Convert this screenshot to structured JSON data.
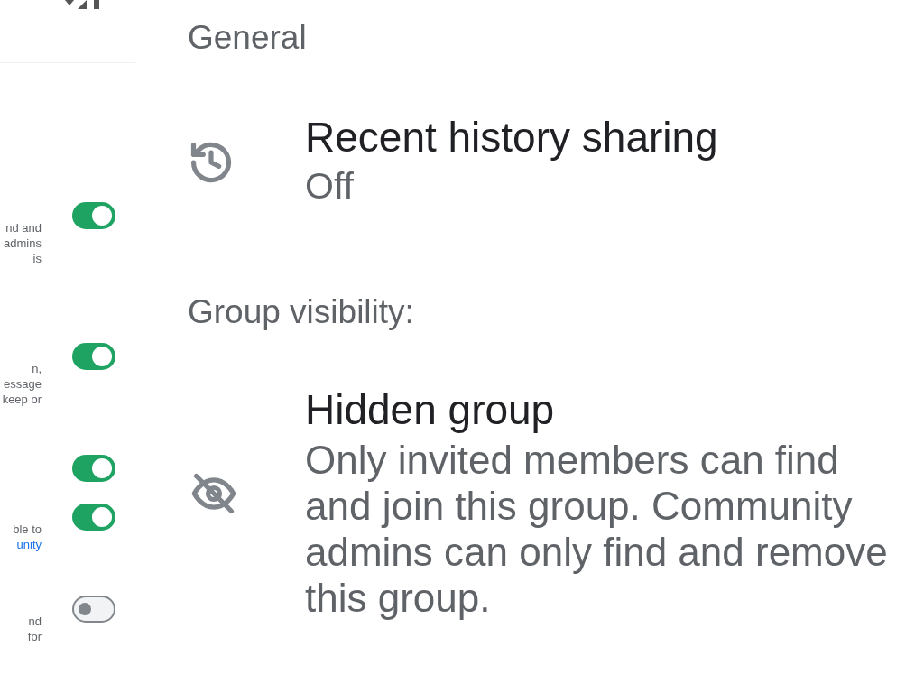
{
  "side_panel": {
    "rows": [
      {
        "lines": [
          {
            "text": "nd and",
            "link": false
          },
          {
            "text": "admins",
            "link": false
          },
          {
            "text": "is",
            "link": false
          }
        ],
        "on": true
      },
      {
        "lines": [
          {
            "text": "n,",
            "link": false
          },
          {
            "text": "essage",
            "link": false
          },
          {
            "text": "keep or",
            "link": false
          }
        ],
        "on": true
      },
      {
        "lines": [],
        "on": true
      },
      {
        "lines": [
          {
            "text": "ble to",
            "link": false
          },
          {
            "text": "unity",
            "link": true
          }
        ],
        "on": true
      },
      {
        "lines": [
          {
            "text": "nd",
            "link": false
          },
          {
            "text": "for",
            "link": false
          }
        ],
        "on": false
      }
    ]
  },
  "main": {
    "section_title": "General",
    "history": {
      "title": "Recent history sharing",
      "value": "Off"
    },
    "visibility_label": "Group visibility:",
    "visibility": {
      "title": "Hidden group",
      "description": "Only invited members can find and join this group. Community admins can only find and remove this group."
    }
  }
}
